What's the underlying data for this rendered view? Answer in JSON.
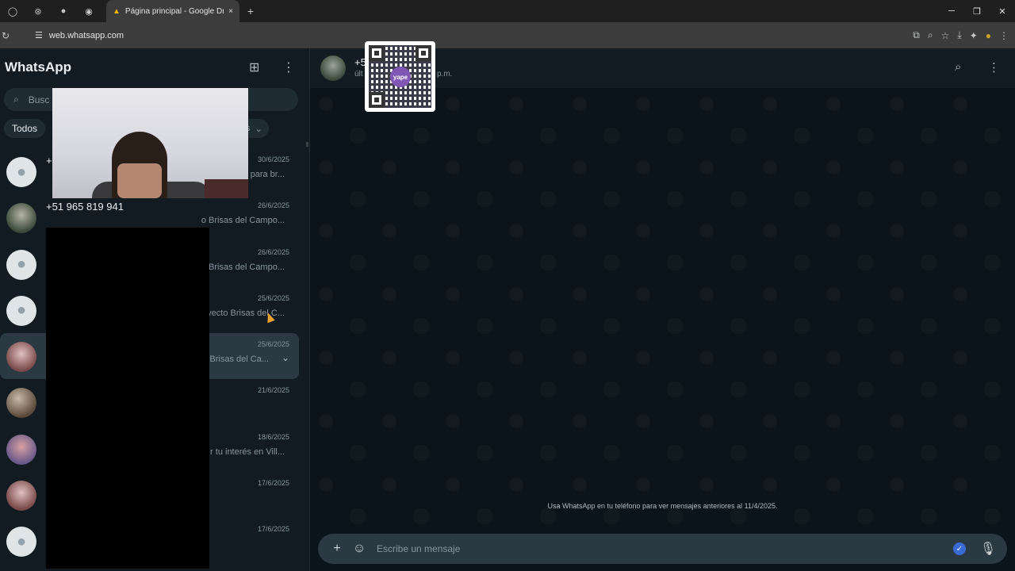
{
  "browser": {
    "tab_title": "Página principal - Google Drive",
    "new_tab": "+",
    "url": "web.whatsapp.com",
    "win_minimize": "─",
    "win_restore": "❐",
    "win_close": "✕",
    "tab_close": "×"
  },
  "sidebar": {
    "brand": "WhatsApp",
    "search_placeholder": "Busc",
    "filters": [
      "Todos"
    ],
    "filter_more": "as",
    "chats": [
      {
        "name": "+",
        "date": "30/6/2025",
        "preview": "o para br...",
        "avatar": "default"
      },
      {
        "name": "+51 965 819 941",
        "date": "26/6/2025",
        "preview": "o Brisas del Campo...",
        "avatar": "photo2"
      },
      {
        "name": "",
        "date": "26/6/2025",
        "preview": "o Brisas del Campo...",
        "avatar": "default"
      },
      {
        "name": "",
        "date": "25/6/2025",
        "preview": "oyecto Brisas del C...",
        "avatar": "default"
      },
      {
        "name": "",
        "date": "25/6/2025",
        "preview": "o Brisas del Ca...",
        "avatar": "photo4",
        "selected": true
      },
      {
        "name": "",
        "date": "21/6/2025",
        "preview": "",
        "avatar": "photo"
      },
      {
        "name": "",
        "date": "18/6/2025",
        "preview": "r tu interés en Vill...",
        "avatar": "photo3"
      },
      {
        "name": "",
        "date": "17/6/2025",
        "preview": "",
        "avatar": "photo4"
      },
      {
        "name": "",
        "date": "17/6/2025",
        "preview": "",
        "avatar": "default"
      }
    ]
  },
  "conversation": {
    "name": "+5",
    "status_left": "últ",
    "status_right": "p.m.",
    "qr_logo": "yape",
    "notice": "Usa WhatsApp en tu teléfono para ver mensajes anteriores al 11/4/2025.",
    "composer_placeholder": "Escribe un mensaje"
  },
  "colors": {
    "panel": "#111b21",
    "background": "#0b141a",
    "composer": "#2a3942"
  }
}
